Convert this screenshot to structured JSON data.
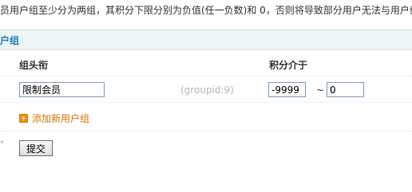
{
  "notice": {
    "text": "员用户组至少分为两组，其积分下限分别为负值(任一负数)和 0，否则将导致部分用户无法与用户组"
  },
  "section": {
    "title": "户组"
  },
  "table": {
    "columns": [
      "组头衔",
      "积分介于"
    ],
    "rows": [
      {
        "title_value": "限制会员",
        "groupid_text": "(groupid:9)",
        "credits_lower": "-9999",
        "range_sep": "~",
        "credits_upper": "0"
      }
    ]
  },
  "add_group": {
    "label": "添加新用户组",
    "icon": "plus-square-icon",
    "color": "#d97500"
  },
  "edge_mark": "°",
  "submit": {
    "label": "提交"
  },
  "colors": {
    "section_bar": "#edf4f8",
    "section_title": "#1f7db3",
    "groupid_gray": "#b9b9b9",
    "input_border": "#7f9db9"
  }
}
